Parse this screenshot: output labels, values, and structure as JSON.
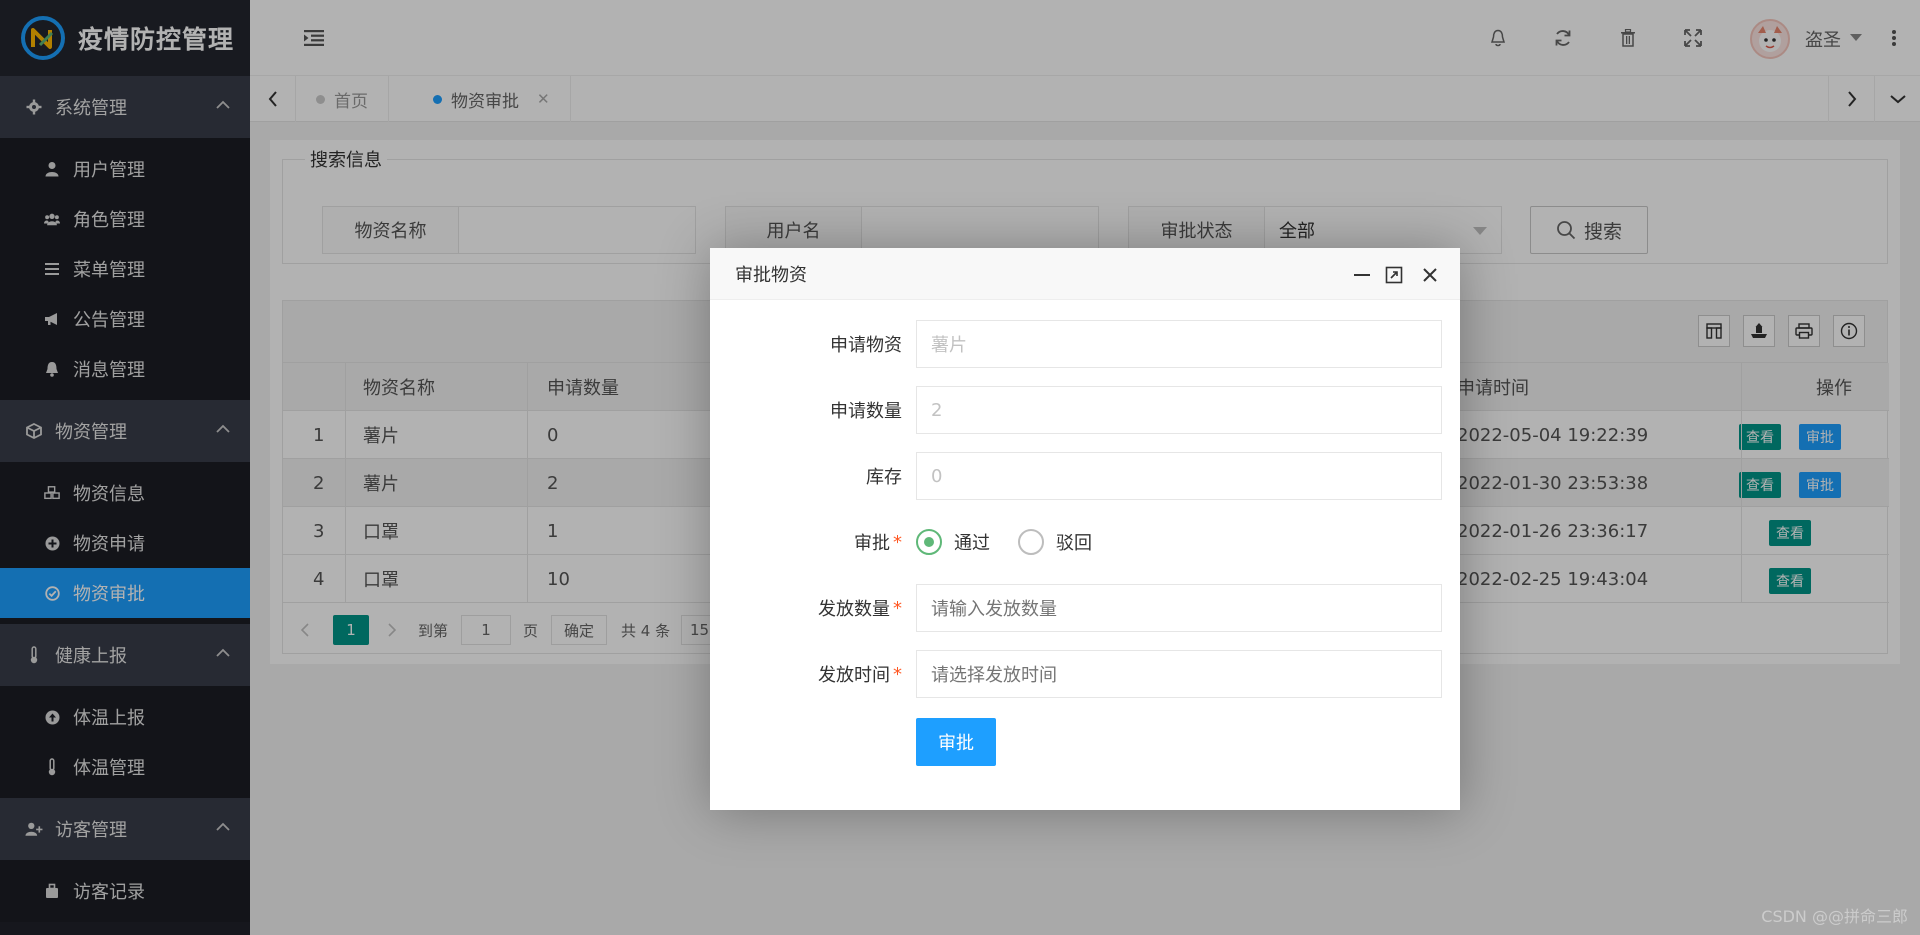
{
  "app": {
    "title": "疫情防控管理"
  },
  "sidebar": {
    "groups": [
      {
        "label": "系统管理",
        "icon": "gear-icon",
        "items": [
          {
            "label": "用户管理",
            "icon": "user-icon"
          },
          {
            "label": "角色管理",
            "icon": "users-icon"
          },
          {
            "label": "菜单管理",
            "icon": "bars-icon"
          },
          {
            "label": "公告管理",
            "icon": "bullhorn-icon"
          },
          {
            "label": "消息管理",
            "icon": "bell-icon"
          }
        ]
      },
      {
        "label": "物资管理",
        "icon": "cube-icon",
        "items": [
          {
            "label": "物资信息",
            "icon": "cubes-icon"
          },
          {
            "label": "物资申请",
            "icon": "plus-circle-icon"
          },
          {
            "label": "物资审批",
            "icon": "check-circle-icon",
            "active": true
          }
        ]
      },
      {
        "label": "健康上报",
        "icon": "thermometer-icon",
        "items": [
          {
            "label": "体温上报",
            "icon": "arrow-up-circle-icon"
          },
          {
            "label": "体温管理",
            "icon": "thermometer-icon"
          }
        ]
      },
      {
        "label": "访客管理",
        "icon": "user-plus-icon",
        "items": [
          {
            "label": "访客记录",
            "icon": "suitcase-icon"
          }
        ]
      }
    ]
  },
  "header": {
    "user_name": "盗圣"
  },
  "tabs": [
    {
      "label": "首页",
      "active": false
    },
    {
      "label": "物资审批",
      "active": true,
      "closable": true
    }
  ],
  "search": {
    "legend": "搜索信息",
    "fields": [
      {
        "label": "物资名称",
        "value": ""
      },
      {
        "label": "用户名",
        "value": ""
      },
      {
        "label": "审批状态",
        "value": "全部"
      }
    ],
    "button": "搜索"
  },
  "table": {
    "columns": [
      "",
      "物资名称",
      "申请数量",
      "申请时间",
      "操作"
    ],
    "rows": [
      {
        "no": "1",
        "name": "薯片",
        "qty": "0",
        "time": "2022-05-04 19:22:39",
        "actions": [
          "查看",
          "审批"
        ]
      },
      {
        "no": "2",
        "name": "薯片",
        "qty": "2",
        "time": "2022-01-30 23:53:38",
        "actions": [
          "查看",
          "审批"
        ]
      },
      {
        "no": "3",
        "name": "口罩",
        "qty": "1",
        "time": "2022-01-26 23:36:17",
        "actions": [
          "查看"
        ]
      },
      {
        "no": "4",
        "name": "口罩",
        "qty": "10",
        "time": "2022-02-25 19:43:04",
        "actions": [
          "查看"
        ]
      }
    ],
    "pager": {
      "current": "1",
      "goto_label": "到第",
      "goto_value": "1",
      "page_label": "页",
      "confirm": "确定",
      "total": "共 4 条",
      "page_size": "15"
    }
  },
  "dialog": {
    "title": "审批物资",
    "fields": {
      "material": {
        "label": "申请物资",
        "value": "薯片"
      },
      "quantity": {
        "label": "申请数量",
        "value": "2"
      },
      "stock": {
        "label": "库存",
        "value": "0"
      },
      "approve": {
        "label": "审批",
        "options": [
          "通过",
          "驳回"
        ],
        "selected": "通过"
      },
      "issue_qty": {
        "label": "发放数量",
        "placeholder": "请输入发放数量"
      },
      "issue_time": {
        "label": "发放时间",
        "placeholder": "请选择发放时间"
      }
    },
    "submit": "审批"
  },
  "watermark": "CSDN @@拼命三郎",
  "colors": {
    "accent": "#1e9fff",
    "teal": "#009688",
    "sidebar_bg": "#20222a",
    "sidebar_group": "#393d49",
    "radio_on": "#5fb878"
  }
}
